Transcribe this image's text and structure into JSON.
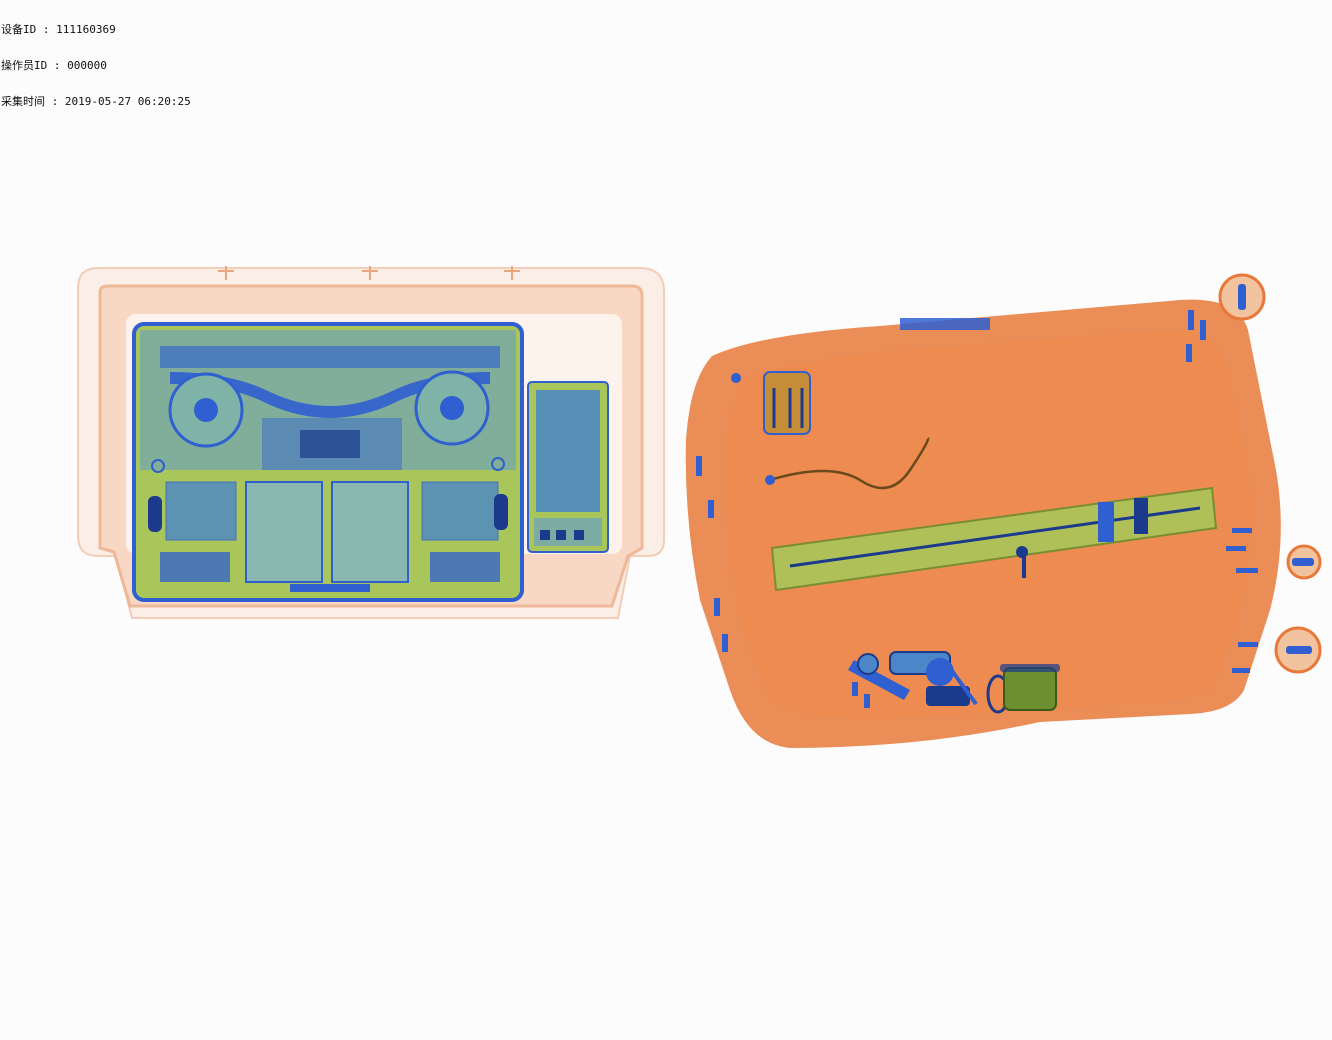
{
  "overlay": {
    "device_id_label": "设备ID",
    "device_id_value": "111160369",
    "operator_id_label": "操作员ID",
    "operator_id_value": "000000",
    "capture_time_label": "采集时间",
    "capture_time_value": "2019-05-27 06:20:25",
    "separator": " : "
  },
  "palette": {
    "background": "#fcfcfc",
    "organic_orange": "#e8793a",
    "organic_light": "#f6c7a8",
    "mixed_green": "#8fc24a",
    "metal_blue": "#2f5fd0",
    "dense_navy": "#1b3a8c"
  },
  "objects": [
    {
      "name": "tray-with-laptop",
      "icon": "laptop-icon"
    },
    {
      "name": "power-bank",
      "icon": "battery-icon"
    },
    {
      "name": "backpack",
      "icon": "bag-icon"
    }
  ]
}
